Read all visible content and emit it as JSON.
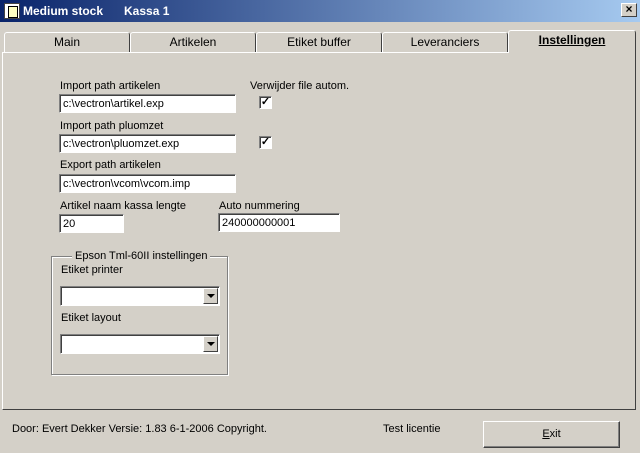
{
  "window": {
    "title": "Medium stock",
    "subtitle": "Kassa 1",
    "close_glyph": "×"
  },
  "tabs": [
    {
      "label": "Main"
    },
    {
      "label": "Artikelen"
    },
    {
      "label": "Etiket buffer"
    },
    {
      "label": "Leveranciers"
    },
    {
      "label": "Instellingen",
      "active": true
    }
  ],
  "settings": {
    "import_artikelen_label": "Import path artikelen",
    "import_artikelen_value": "c:\\vectron\\artikel.exp",
    "remove_file_label": "Verwijder file autom.",
    "remove_file_artikelen_checked": true,
    "import_pluomzet_label": "Import path pluomzet",
    "import_pluomzet_value": "c:\\vectron\\pluomzet.exp",
    "remove_file_pluomzet_checked": true,
    "export_artikelen_label": "Export path  artikelen",
    "export_artikelen_value": "c:\\vectron\\vcom\\vcom.imp",
    "name_length_label": "Artikel naam kassa lengte",
    "name_length_value": "20",
    "auto_numbering_label": "Auto nummering",
    "auto_numbering_value": "240000000001",
    "check_glyph": "✓"
  },
  "printer_group": {
    "title": "Epson Tml-60II instellingen",
    "printer_label": "Etiket printer",
    "printer_value": "",
    "layout_label": "Etiket layout",
    "layout_value": ""
  },
  "status": {
    "credits": "Door: Evert Dekker Versie: 1.83  6-1-2006 Copyright.",
    "license": "Test licentie",
    "exit_label_first": "E",
    "exit_label_rest": "xit"
  }
}
